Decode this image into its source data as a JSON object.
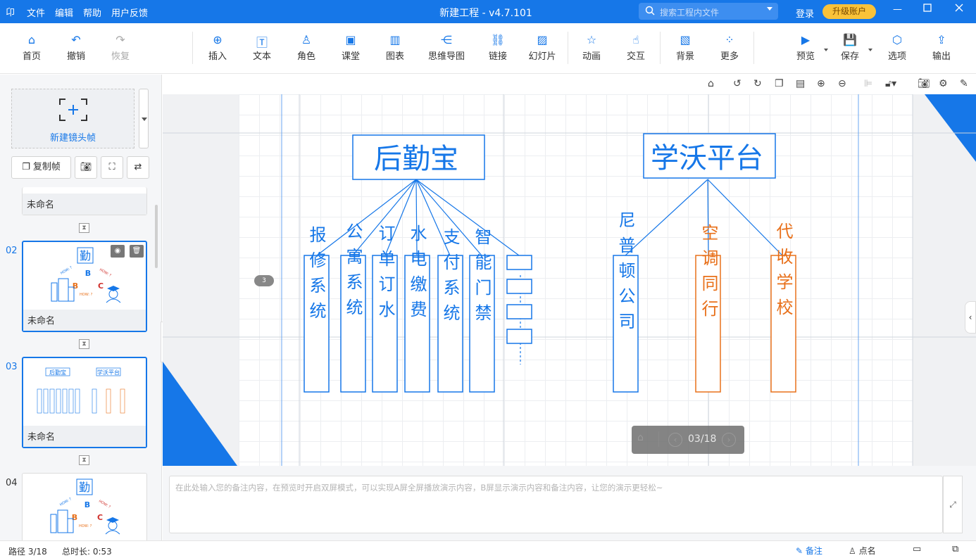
{
  "titlebar": {
    "logo": "卬",
    "menus": [
      "文件",
      "编辑",
      "帮助",
      "用户反馈"
    ],
    "title": "新建工程 - v4.7.101",
    "search_placeholder": "搜索工程内文件",
    "login": "登录",
    "upgrade": "升级账户"
  },
  "toolbar": {
    "home": "首页",
    "undo": "撤销",
    "redo": "恢复",
    "insert": "插入",
    "text": "文本",
    "role": "角色",
    "class": "课堂",
    "chart": "图表",
    "mindmap": "思维导图",
    "link": "链接",
    "slideshow": "幻灯片",
    "animation": "动画",
    "interact": "交互",
    "background": "背景",
    "more": "更多",
    "preview": "预览",
    "save": "保存",
    "options": "选项",
    "export": "输出"
  },
  "sidebar": {
    "new_frame": "新建镜头帧",
    "copy_frame": "复制帧",
    "slides": [
      {
        "num": "",
        "name": "未命名"
      },
      {
        "num": "02",
        "name": "未命名",
        "thumb": {
          "top": "勤",
          "b1": "B",
          "b2": "B",
          "c": "C",
          "how1": "HOW: ?",
          "how2": "HOW: ?",
          "how3": "HOW: ?"
        }
      },
      {
        "num": "03",
        "name": "未命名",
        "thumb": {
          "t1": "后勤宝",
          "t2": "学沃平台"
        }
      },
      {
        "num": "04",
        "name": "",
        "thumb": {
          "top": "勤",
          "b1": "B",
          "b2": "B",
          "c": "C",
          "how1": "HOW: ?",
          "how2": "HOW: ?",
          "how3": "HOW: ?"
        }
      }
    ]
  },
  "canvas": {
    "frame_indicator": "3",
    "page": "03/18",
    "left_root": "后勤宝",
    "right_root": "学沃平台",
    "left_children": [
      "报修系统",
      "公寓系统",
      "订单订水",
      "水电缴费",
      "支付系统",
      "智能门禁"
    ],
    "right_children": [
      "尼普顿公司",
      "空调同行",
      "代收学校"
    ],
    "blue": "#1677e8",
    "orange": "#e8701a"
  },
  "notes": {
    "placeholder": "在此处输入您的备注内容，在预览时开启双屏模式，可以实现A屏全屏播放演示内容，B屏显示演示内容和备注内容，让您的演示更轻松~"
  },
  "status": {
    "path": "路径 3/18",
    "duration": "总时长: 0:53",
    "notes": "备注",
    "rollcall": "点名"
  }
}
